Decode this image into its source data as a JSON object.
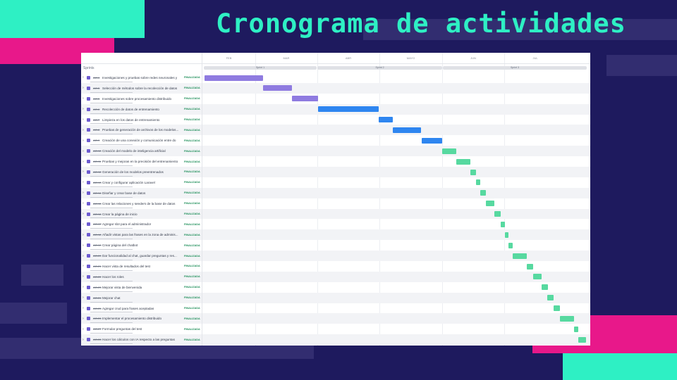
{
  "slide": {
    "title": "Cronograma de actividades",
    "colors": {
      "background": "#1e1a5e",
      "accent_cyan": "#2ef0c4",
      "accent_pink": "#e8188a"
    }
  },
  "timeline": {
    "sprints_label": "Sprints",
    "months": [
      "FEB",
      "MAR",
      "ABR",
      "MAYO",
      "JUN",
      "JUL"
    ],
    "sprints": [
      "Sprint 1",
      "Sprint 2",
      "Sprint 3"
    ],
    "status_colors": {
      "FINALIZADA": "#1f8f5a"
    },
    "bar_colors": {
      "purple": "#8f7be0",
      "blue": "#2f86f0",
      "green": "#57d9a0"
    },
    "items": [
      {
        "key": "AG-4",
        "summary": "Investigaciones y pruebas sobre redes neuronales y",
        "status": "FINALIZADA",
        "color": "purple"
      },
      {
        "key": "AG-5",
        "summary": "Selección de métodos sobre la recolección de datos",
        "status": "FINALIZADA",
        "color": "purple"
      },
      {
        "key": "AG-5",
        "summary": "Investigaciones sobre procesamiento distribuido",
        "status": "FINALIZADA",
        "color": "purple"
      },
      {
        "key": "AG-6",
        "summary": "Recolección de datos de entrenamiento",
        "status": "FINALIZADA",
        "color": "blue"
      },
      {
        "key": "AG-7",
        "summary": "Limpieza en los datos de entrenamiento",
        "status": "FINALIZADA",
        "color": "blue"
      },
      {
        "key": "AG-8",
        "summary": "Pruebas de generación de archivos de los modelos...",
        "status": "FINALIZADA",
        "color": "blue"
      },
      {
        "key": "AG-9",
        "summary": "Creación de una conexión y comunicación entre do",
        "status": "FINALIZADA",
        "color": "blue"
      },
      {
        "key": "AG-10",
        "summary": "Creación del modelo de inteligencia artificial",
        "status": "FINALIZADA",
        "color": "green"
      },
      {
        "key": "AG-11",
        "summary": "Pruebas y mejoras en la precisión del entrenamiento",
        "status": "FINALIZADA",
        "color": "green"
      },
      {
        "key": "AG-12",
        "summary": "Generación de los modelos preentrenados",
        "status": "FINALIZADA",
        "color": "green"
      },
      {
        "key": "AG-13",
        "summary": "Crear y configurar aplicación Laravel",
        "status": "FINALIZADA",
        "color": "green"
      },
      {
        "key": "AG-14",
        "summary": "Diseñar y crear base de datos",
        "status": "FINALIZADA",
        "color": "green"
      },
      {
        "key": "AG-15",
        "summary": "Crear las relaciones y seeders de la base de datos",
        "status": "FINALIZADA",
        "color": "green"
      },
      {
        "key": "AG-16",
        "summary": "Crear la página de inicio",
        "status": "FINALIZADA",
        "color": "green"
      },
      {
        "key": "AG-17",
        "summary": "Agregar slot para el administrador",
        "status": "FINALIZADA",
        "color": "green"
      },
      {
        "key": "AG-18",
        "summary": "Añadir vistas para las frases en la zona de adminis...",
        "status": "FINALIZADA",
        "color": "green"
      },
      {
        "key": "AG-19",
        "summary": "Crear página del chatbot",
        "status": "FINALIZADA",
        "color": "green"
      },
      {
        "key": "AG-20",
        "summary": "Dar funcionalidad al chat, guardar preguntas y res...",
        "status": "FINALIZADA",
        "color": "green"
      },
      {
        "key": "AG-21",
        "summary": "Hacer vista de resultados del test",
        "status": "FINALIZADA",
        "color": "green"
      },
      {
        "key": "AG-22",
        "summary": "Hacer los roles",
        "status": "FINALIZADA",
        "color": "green"
      },
      {
        "key": "AG-23",
        "summary": "Mejorar vista de bienvenida",
        "status": "FINALIZADA",
        "color": "green"
      },
      {
        "key": "AG-24",
        "summary": "Mejorar chat",
        "status": "FINALIZADA",
        "color": "green"
      },
      {
        "key": "AG-25",
        "summary": "Agregar crud para frases aceptadas",
        "status": "FINALIZADA",
        "color": "green"
      },
      {
        "key": "AG-26",
        "summary": "Implementar el procesamiento distribuido",
        "status": "FINALIZADA",
        "color": "green"
      },
      {
        "key": "AG-27",
        "summary": "Formular preguntas del test",
        "status": "FINALIZADA",
        "color": "green"
      },
      {
        "key": "AG-28",
        "summary": "Hacer los cálculos con IA respecto a las preguntas",
        "status": "FINALIZADA",
        "color": "green"
      }
    ]
  }
}
